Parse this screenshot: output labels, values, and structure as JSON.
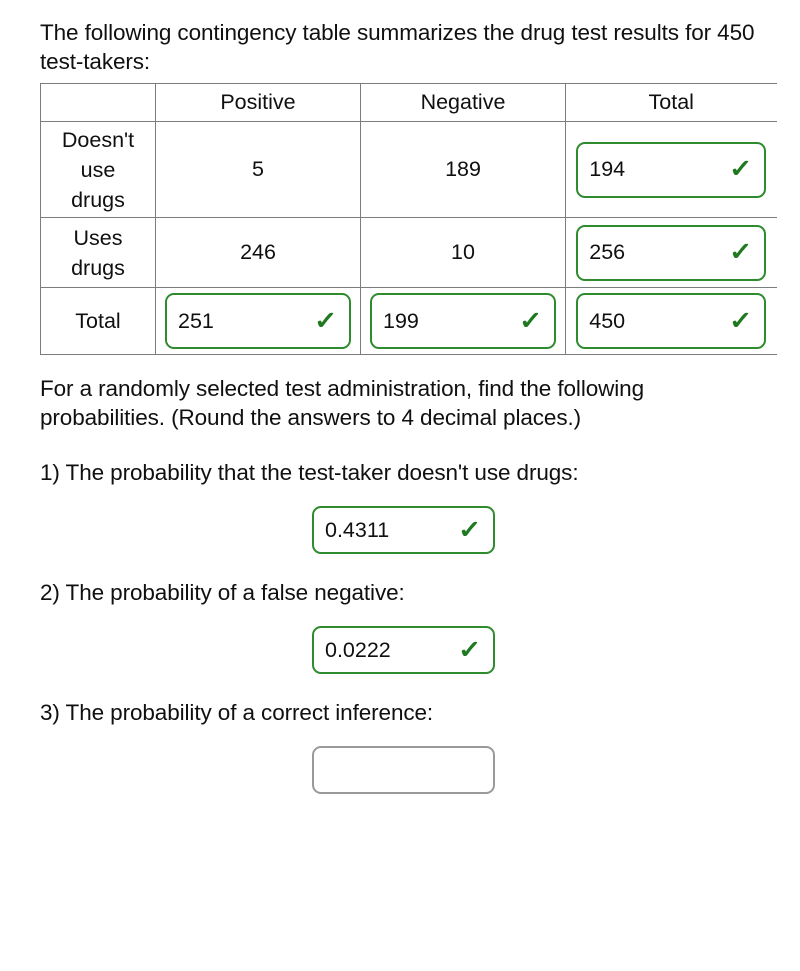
{
  "intro": {
    "text": "The following contingency table summarizes the drug test results for 450 test-takers:"
  },
  "table": {
    "headers": [
      "",
      "Positive",
      "Negative",
      "Total"
    ],
    "rows": [
      {
        "label": "Doesn't use drugs",
        "label_lines": [
          "Doesn't",
          "use",
          "drugs"
        ],
        "positive": "5",
        "negative": "189",
        "total": "194",
        "total_status": "correct"
      },
      {
        "label": "Uses drugs",
        "label_lines": [
          "Uses",
          "drugs"
        ],
        "positive": "246",
        "negative": "10",
        "total": "256",
        "total_status": "correct"
      },
      {
        "label": "Total",
        "label_lines": [
          "Total"
        ],
        "positive": "251",
        "positive_status": "correct",
        "negative": "199",
        "negative_status": "correct",
        "total": "450",
        "total_status": "correct"
      }
    ]
  },
  "instructions": {
    "text": "For a randomly selected test administration, find the following probabilities. (Round the answers to 4 decimal places.)"
  },
  "questions": [
    {
      "number": "1)",
      "prompt": "1) The probability that the test-taker doesn't use drugs:",
      "answer": "0.4311",
      "status": "correct"
    },
    {
      "number": "2)",
      "prompt": "2) The probability of a false negative:",
      "answer": "0.0222",
      "status": "correct"
    },
    {
      "number": "3)",
      "prompt": "3) The probability of a correct inference:",
      "answer": "",
      "status": "blank"
    }
  ],
  "icons": {
    "check": "✓"
  },
  "colors": {
    "correct_border": "#2e8b2e",
    "check_mark": "#1f7a1f",
    "blank_border": "#9a9a9a",
    "table_border": "#7c7c7c",
    "text": "#101010"
  }
}
